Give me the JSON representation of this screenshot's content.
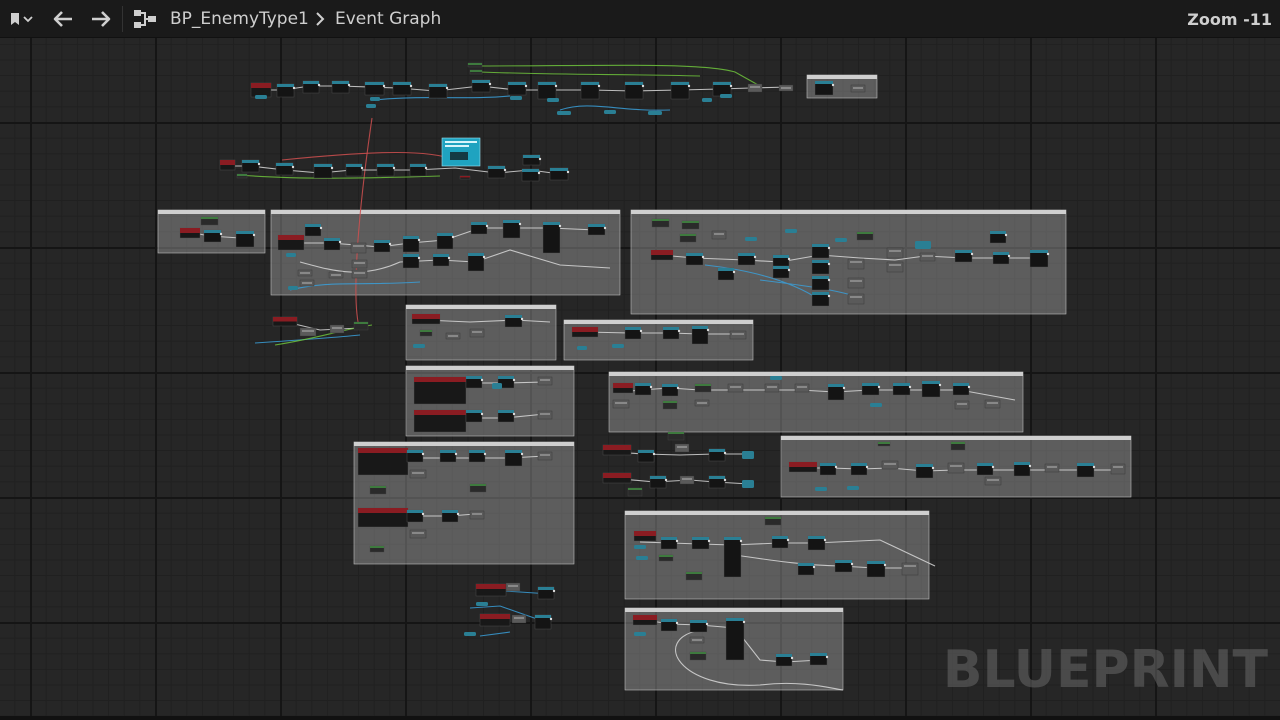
{
  "toolbar": {
    "bookmark_icon": "bookmark-icon",
    "dropdown_icon": "chevron-down-icon",
    "back_icon": "arrow-left-icon",
    "forward_icon": "arrow-right-icon",
    "graph_icon": "event-graph-icon",
    "breadcrumb_blueprint": "BP_EnemyType1",
    "breadcrumb_separator_icon": "chevron-right-icon",
    "breadcrumb_graph": "Event Graph",
    "zoom_label": "Zoom -11"
  },
  "canvas": {
    "watermark": "BLUEPRINT",
    "comment_color": "#aaaaaa",
    "event_node_color": "#8a1c22",
    "function_node_color": "#2a7f94",
    "pure_node_color": "#3e7a3e",
    "highlight_node_color": "#1fa3c0",
    "wire_exec_color": "#d8d8d8",
    "wire_data_colors": [
      "#3a9fd8",
      "#6fc43c",
      "#d05050"
    ]
  }
}
